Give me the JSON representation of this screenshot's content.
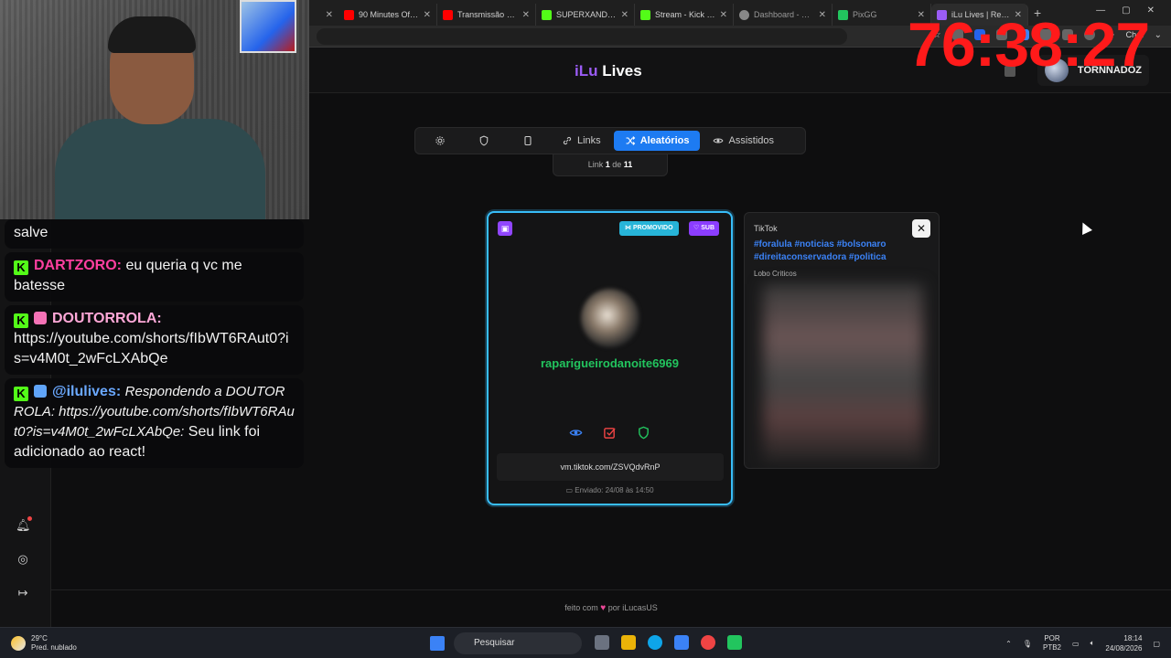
{
  "browser": {
    "tabs": [
      {
        "label": "90 Minutes Of Met...",
        "color": "#ff0000"
      },
      {
        "label": "Transmissão ao viv...",
        "color": "#ff0000"
      },
      {
        "label": "SUPERXANDAO Stre...",
        "color": "#53fc18"
      },
      {
        "label": "Stream - Kick Dash...",
        "color": "#53fc18"
      },
      {
        "label": "Dashboard - LivePix",
        "color": "#888888"
      },
      {
        "label": "PixGG",
        "color": "#22c55e"
      },
      {
        "label": "iLu Lives | React",
        "color": "#9b5cf6"
      }
    ],
    "chat_button": "Chat"
  },
  "timer": "76:38:27",
  "site": {
    "logo_prefix": "iLu",
    "logo_suffix": "Lives",
    "username": "TORNNADOZ"
  },
  "nav": {
    "links_label": "Links",
    "random_label": "Aleatórios",
    "watched_label": "Assistidos",
    "counter_prefix": "Link",
    "counter_current": "1",
    "counter_of": "de",
    "counter_total": "11"
  },
  "card": {
    "promo_badge": "PROMOVIDO",
    "sub_badge": "SUB",
    "username": "rapariguei­rodanoite6969",
    "url": "vm.tiktok.com/ZSVQdvRnP",
    "sent": "Enviado: 24/08 às 14:50"
  },
  "tiktok": {
    "label": "TikTok",
    "tags_line1": "#foralula #noticias #bolsonaro",
    "tags_line2": "#direitaconservadora #politica",
    "author": "Lobo Criticos"
  },
  "footer": {
    "prefix": "feito com",
    "suffix": "por iLucasUS"
  },
  "chat": {
    "msg0": "salve",
    "msg1_nick": "DARTZORO:",
    "msg1_text": "eu queria q vc me batesse",
    "msg2_nick": "DOUTORROLA:",
    "msg2_text": "https://youtube.com/shorts/fIbWT6RAut0?is=v4M0t_2wFcLXAbQe",
    "msg3_nick": "@ilulives:",
    "msg3_reply": "Respondendo a DOUTORROLA: https://youtube.com/shorts/fIbWT6RAut0?is=v4M0t_2wFcLXAbQe:",
    "msg3_text": "Seu link foi adicionado ao react!"
  },
  "taskbar": {
    "temp": "29°C",
    "weather": "Pred. nublado",
    "search": "Pesquisar",
    "lang1": "POR",
    "lang2": "PTB2",
    "time": "18:14",
    "date": "24/08/2026"
  }
}
